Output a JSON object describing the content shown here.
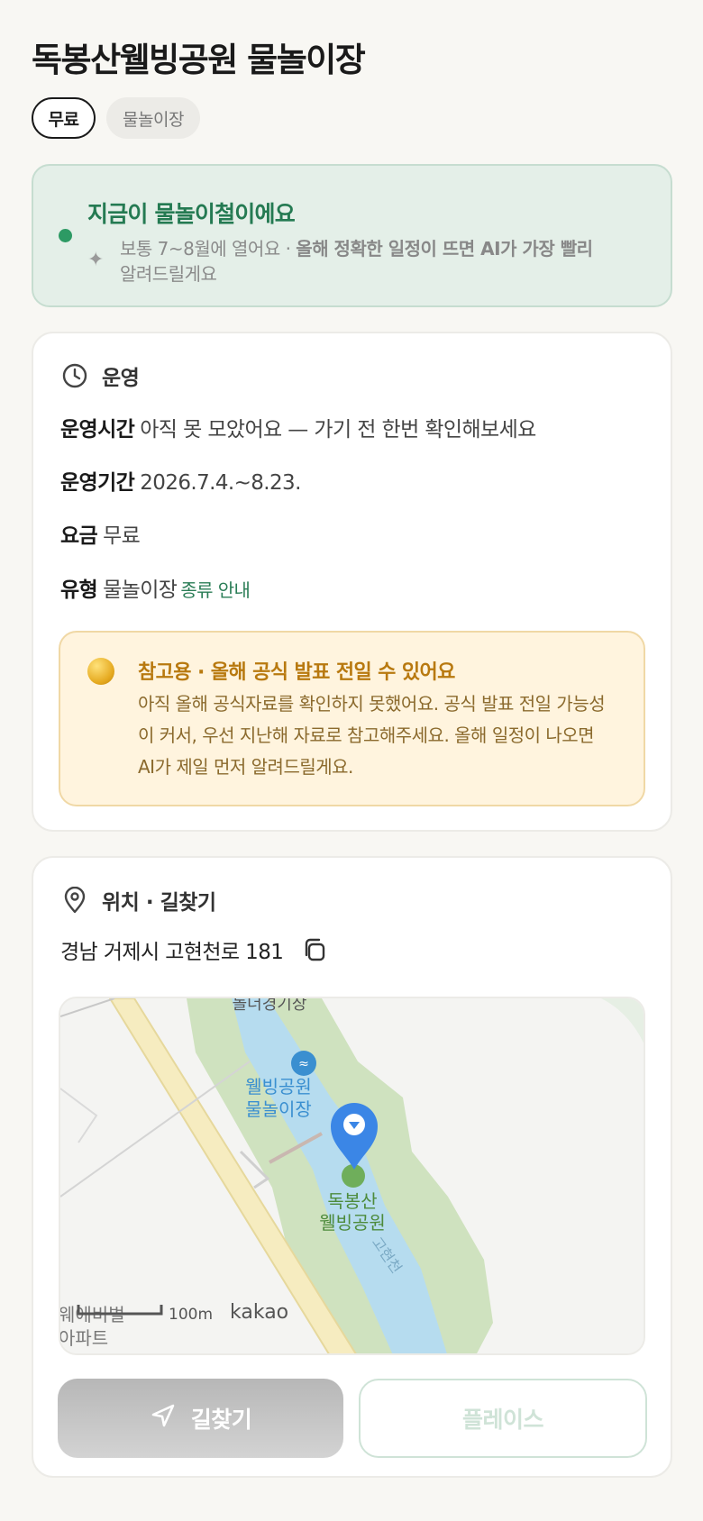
{
  "page_title": "독봉산웰빙공원 물놀이장",
  "chips": {
    "free": "무료",
    "type": "물놀이장"
  },
  "season": {
    "headline": "지금이 물놀이철이에요",
    "desc_plain": "보통 7~8월에 열어요 · ",
    "desc_bold": "올해 정확한 일정이 뜨면 AI가 가장 빨리",
    "desc_line2": "알려드릴게요",
    "colors": {
      "accent": "#2d9a64",
      "bg": "#e4efe8"
    }
  },
  "operation": {
    "title": "운영",
    "hours_label": "운영시간",
    "hours_value": "아직 못 모았어요 — 가기 전 한번 확인해보세요",
    "period_label": "운영기간",
    "period_value": "2026.7.4.~8.23.",
    "fee_label": "요금",
    "fee_value": "무료",
    "type_label": "유형",
    "type_value": "물놀이장",
    "type_link": "종류 안내",
    "notice": {
      "title": "참고용 · 올해 공식 발표 전일 수 있어요",
      "body": "아직 올해 공식자료를 확인하지 못했어요. 공식 발표 전일 가능성이 커서, 우선 지난해 자료로 참고해주세요. 올해 일정이 나오면 AI가 제일 먼저 알려드릴게요."
    }
  },
  "location": {
    "title": "위치 · 길찾기",
    "address": "경남 거제시 고현천로 181",
    "map": {
      "label_top": "돌더경기장",
      "poi_pool_line1": "웰빙공원",
      "poi_pool_line2": "물놀이장",
      "poi_park_line1": "독봉산",
      "poi_park_line2": "웰빙공원",
      "stream_label": "고현천",
      "bottom_left_line1": "웨에비벌",
      "bottom_left_line2": "아파트",
      "scale": "100m",
      "brand": "kakao"
    }
  },
  "buttons": {
    "route": "길찾기",
    "place": "플레이스"
  }
}
